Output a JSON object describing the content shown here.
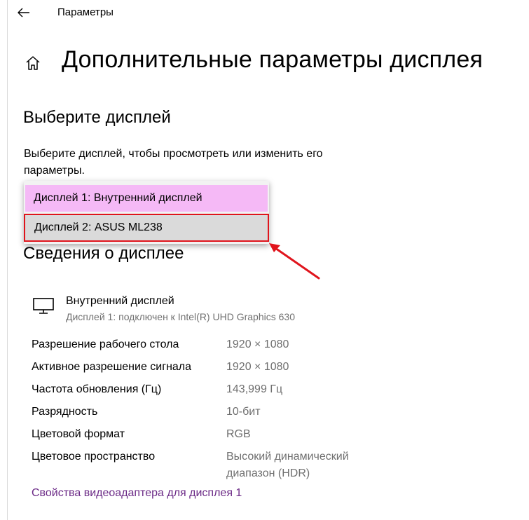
{
  "window": {
    "title": "Параметры"
  },
  "page": {
    "title": "Дополнительные параметры дисплея"
  },
  "select_display": {
    "heading": "Выберите дисплей",
    "description": "Выберите дисплей, чтобы просмотреть или изменить его параметры.",
    "options": [
      {
        "label": "Дисплей 1: Внутренний дисплей",
        "highlight_color": "#f5b9f6"
      },
      {
        "label": "Дисплей 2: ASUS ML238",
        "outline_color": "#e0141c"
      }
    ]
  },
  "display_info": {
    "heading": "Сведения о дисплее",
    "display_name": "Внутренний дисплей",
    "connection": "Дисплей 1: подключен к Intel(R) UHD Graphics 630",
    "properties": [
      {
        "label": "Разрешение рабочего стола",
        "value": "1920 × 1080"
      },
      {
        "label": "Активное разрешение сигнала",
        "value": "1920 × 1080"
      },
      {
        "label": "Частота обновления (Гц)",
        "value": "143,999 Гц"
      },
      {
        "label": "Разрядность",
        "value": "10-бит"
      },
      {
        "label": "Цветовой формат",
        "value": "RGB"
      },
      {
        "label": "Цветовое пространство",
        "value": "Высокий динамический диапазон (HDR)"
      }
    ],
    "adapter_link": "Свойства видеоадаптера для дисплея 1"
  },
  "colors": {
    "link": "#6b2a86",
    "annotation": "#e0141c",
    "secondary_text": "#6f6f6f"
  },
  "icons": {
    "back": "back-arrow-icon",
    "home": "home-icon",
    "monitor": "monitor-icon"
  }
}
